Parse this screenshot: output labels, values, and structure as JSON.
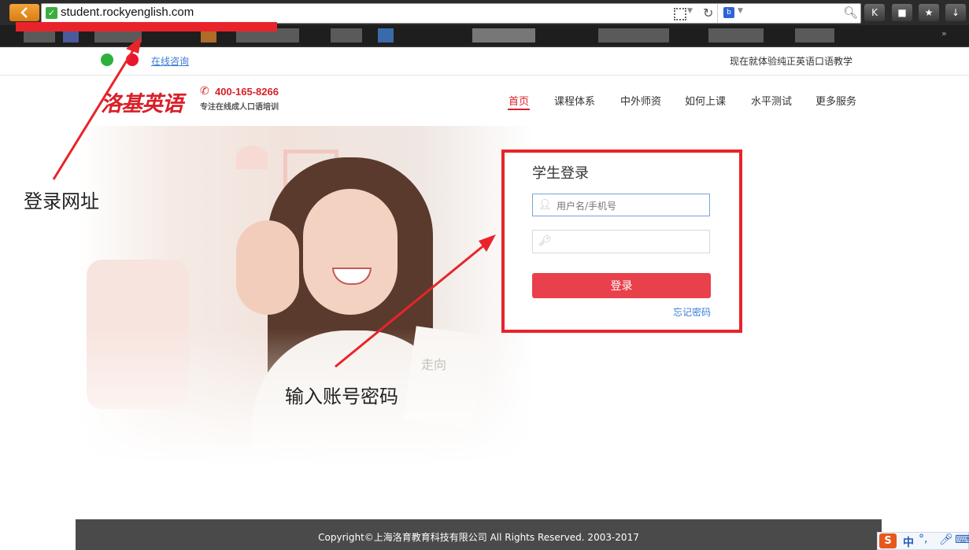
{
  "browser": {
    "url": "student.rockyenglish.com",
    "back_icon": "chevron-left-icon",
    "reload_icon": "reload-icon",
    "search_icon": "magnifier-icon"
  },
  "topbar": {
    "consult": "在线咨询",
    "slogan": "现在就体验纯正英语口语教学"
  },
  "header": {
    "logo": "洛基英语",
    "phone": "400-165-8266",
    "tagline": "专注在线成人口语培训",
    "nav": [
      "首页",
      "课程体系",
      "中外师资",
      "如何上课",
      "水平测试",
      "更多服务"
    ]
  },
  "hero": {
    "book_text": "走向"
  },
  "login": {
    "title": "学生登录",
    "username_placeholder": "用户名/手机号",
    "password_placeholder": "",
    "submit": "登录",
    "forgot": "忘记密码"
  },
  "annotations": {
    "url_note": "登录网址",
    "account_note": "输入账号密码"
  },
  "footer": {
    "copyright": "Copyright©上海洛育教育科技有限公司 All Rights Reserved. 2003-2017"
  },
  "ime": {
    "logo": "S",
    "mode": "中",
    "punct": "°,"
  },
  "colors": {
    "brand_red": "#d81f28",
    "button_red": "#e8414b",
    "annotation_red": "#e8242a",
    "link_blue": "#3b7bd6"
  }
}
